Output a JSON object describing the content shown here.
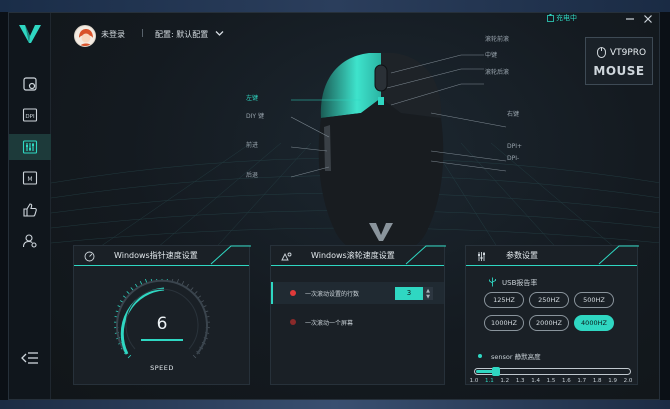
{
  "window": {
    "charging_status": "充电中",
    "login_label": "未登录",
    "separator": "|",
    "config_label": "配置: 默认配置"
  },
  "model": {
    "name": "VT9PRO",
    "type": "MOUSE"
  },
  "sidebar": {
    "items": [
      {
        "icon": "home-mouse-icon",
        "active": false
      },
      {
        "icon": "dpi-icon",
        "active": false
      },
      {
        "icon": "performance-sliders-icon",
        "active": true
      },
      {
        "icon": "macro-icon",
        "active": false
      },
      {
        "icon": "thumbs-up-icon",
        "active": false
      },
      {
        "icon": "user-settings-icon",
        "active": false
      }
    ]
  },
  "mouse_labels": {
    "left_key": "左键",
    "diy_key": "DIY 键",
    "forward": "前进",
    "back": "后退",
    "scroll_up": "滚轮前滚",
    "middle": "中键",
    "scroll_down": "滚轮后滚",
    "right_key": "右键",
    "dpi_plus": "DPI+",
    "dpi_minus": "DPI-"
  },
  "pointer_card": {
    "title": "Windows指针速度设置",
    "value": "6",
    "speed_label": "SPEED",
    "level": 6,
    "max": 11
  },
  "scroll_card": {
    "title": "Windows滚轮速度设置",
    "option1": "一次滚动设置的行数",
    "option1_value": "3",
    "option2": "一次滚动一个屏幕"
  },
  "params_card": {
    "title": "参数设置",
    "usb_label": "USB报告率",
    "rates": [
      "125HZ",
      "250HZ",
      "500HZ",
      "1000HZ",
      "2000HZ",
      "4000HZ"
    ],
    "selected_rate": "4000HZ",
    "sensor_label": "sensor 静默高度",
    "ticks": [
      "1.0",
      "1.1",
      "1.2",
      "1.3",
      "1.4",
      "1.5",
      "1.6",
      "1.7",
      "1.8",
      "1.9",
      "2.0"
    ],
    "selected_tick": "1.1"
  },
  "colors": {
    "accent": "#2fd7c2",
    "background": "#141a20",
    "card": "#1a2026",
    "dot_active": "#e03a3a",
    "dot_inactive": "#8a2a2a"
  }
}
